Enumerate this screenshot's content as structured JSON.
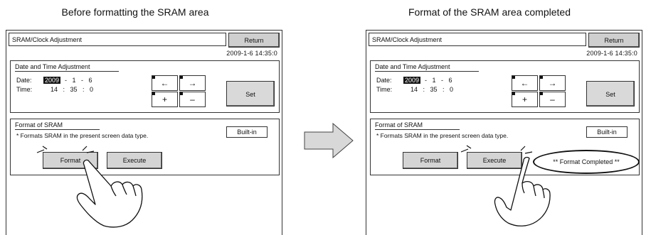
{
  "captions": {
    "before": "Before formatting the SRAM area",
    "after": "Format of the SRAM area completed"
  },
  "screens": {
    "before": {
      "title": "SRAM/Clock Adjustment",
      "return_label": "Return",
      "datetime": "2009-1-6    14:35:0",
      "date_group_title": "Date and Time Adjustment",
      "date_label": "Date:",
      "year": "2009",
      "date_rest": "-   1   -   6",
      "time_label": "Time:",
      "time_value": "14   :   35   :   0",
      "arrows": {
        "left": "←",
        "right": "→",
        "plus": "+",
        "minus": "–"
      },
      "set_label": "Set",
      "format_group_title": "Format of SRAM",
      "note": "* Formats SRAM in the present screen data type.",
      "builtin_label": "Built-in",
      "format_label": "Format",
      "execute_label": "Execute"
    },
    "after": {
      "title": "SRAM/Clock Adjustment",
      "return_label": "Return",
      "datetime": "2009-1-6    14:35:0",
      "date_group_title": "Date and Time Adjustment",
      "date_label": "Date:",
      "year": "2009",
      "date_rest": "-   1   -   6",
      "time_label": "Time:",
      "time_value": "14   :   35   :   0",
      "arrows": {
        "left": "←",
        "right": "→",
        "plus": "+",
        "minus": "–"
      },
      "set_label": "Set",
      "format_group_title": "Format of SRAM",
      "note": "* Formats SRAM in the present screen data type.",
      "builtin_label": "Built-in",
      "format_label": "Format",
      "execute_label": "Execute",
      "completed_label": "** Format Completed **"
    }
  },
  "icons": {
    "transition": "right-arrow-icon",
    "pointer": "hand-pointer-icon"
  },
  "colors": {
    "button_gray": "#d4d4d4",
    "return_gray": "#cfcfcf",
    "arrow_fill": "#d8d8d8",
    "border": "#333333"
  }
}
